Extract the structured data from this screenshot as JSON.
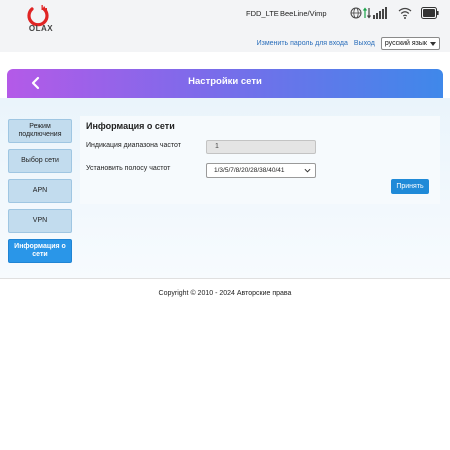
{
  "header": {
    "logo_text": "OLAX",
    "network_type": "FDD_LTE",
    "operator": "BeeLine/Vimp",
    "icons": [
      "globe-icon",
      "data-transfer-icon",
      "signal-icon",
      "wifi-icon",
      "battery-icon"
    ]
  },
  "subbar": {
    "change_password": "Изменить пароль для входа",
    "logout": "Выход",
    "language": "русский язык"
  },
  "banner": {
    "title": "Настройки сети"
  },
  "sidebar": {
    "items": [
      {
        "label": "Режим подключения"
      },
      {
        "label": "Выбор сети"
      },
      {
        "label": "APN"
      },
      {
        "label": "VPN"
      },
      {
        "label": "Информация о сети"
      }
    ],
    "active_index": 4
  },
  "main": {
    "section_title": "Информация о сети",
    "band_indication_label": "Индикация диапазона частот",
    "band_indication_value": "1",
    "set_band_label": "Установить полосу частот",
    "set_band_value": "1/3/5/7/8/20/28/38/40/41",
    "apply_label": "Принять"
  },
  "footer": {
    "copyright": "Copyright © 2010 - 2024 Авторские права"
  },
  "colors": {
    "accent": "#1f8ad8",
    "banner_start": "#b45ae8",
    "banner_end": "#3f88ea",
    "logo_red": "#e02424"
  }
}
